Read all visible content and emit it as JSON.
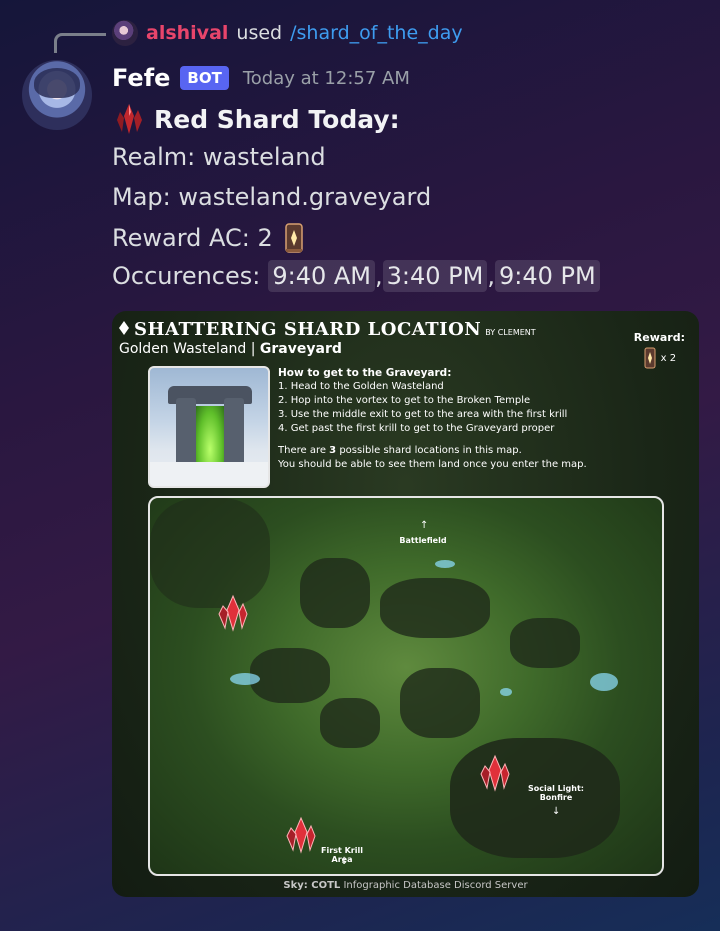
{
  "reply": {
    "username": "alshival",
    "used": "used",
    "command": "/shard_of_the_day"
  },
  "message": {
    "author": "Fefe",
    "bot_tag": "BOT",
    "timestamp": "Today at 12:57 AM",
    "title": "Red Shard Today:",
    "realm": "Realm: wasteland",
    "map": "Map: wasteland.graveyard",
    "reward": "Reward AC: 2",
    "occurrences_label": "Occurences:",
    "occurrences": [
      "9:40 AM",
      "3:40 PM",
      "9:40 PM"
    ],
    "separator": ","
  },
  "card": {
    "title": "SHATTERING SHARD LOCATION",
    "by": "BY CLEMENT",
    "subtitle_place": "Golden Wasteland",
    "subtitle_sep": " | ",
    "subtitle_area": "Graveyard",
    "reward_label": "Reward:",
    "reward_count": "x 2",
    "howto_heading": "How to get to the Graveyard:",
    "steps": [
      "1. Head to the Golden Wasteland",
      "2. Hop into the vortex to get to the Broken Temple",
      "3. Use the middle exit to get to the area with the first krill",
      "4. Get past the first krill to get to the Graveyard proper"
    ],
    "note_pre": "There are ",
    "note_num": "3",
    "note_post": " possible shard locations in this map.",
    "note2": "You should be able to see them land once you enter the map.",
    "map_labels": {
      "battlefield": "Battlefield",
      "social_light": "Social Light:",
      "bonfire": "Bonfire",
      "first_krill": "First Krill Area"
    },
    "footer_bold": "Sky: COTL",
    "footer_rest": " Infographic Database Discord Server"
  },
  "colors": {
    "username": "#e8456b",
    "command": "#3e9cf0",
    "bot_tag": "#5865f2"
  }
}
